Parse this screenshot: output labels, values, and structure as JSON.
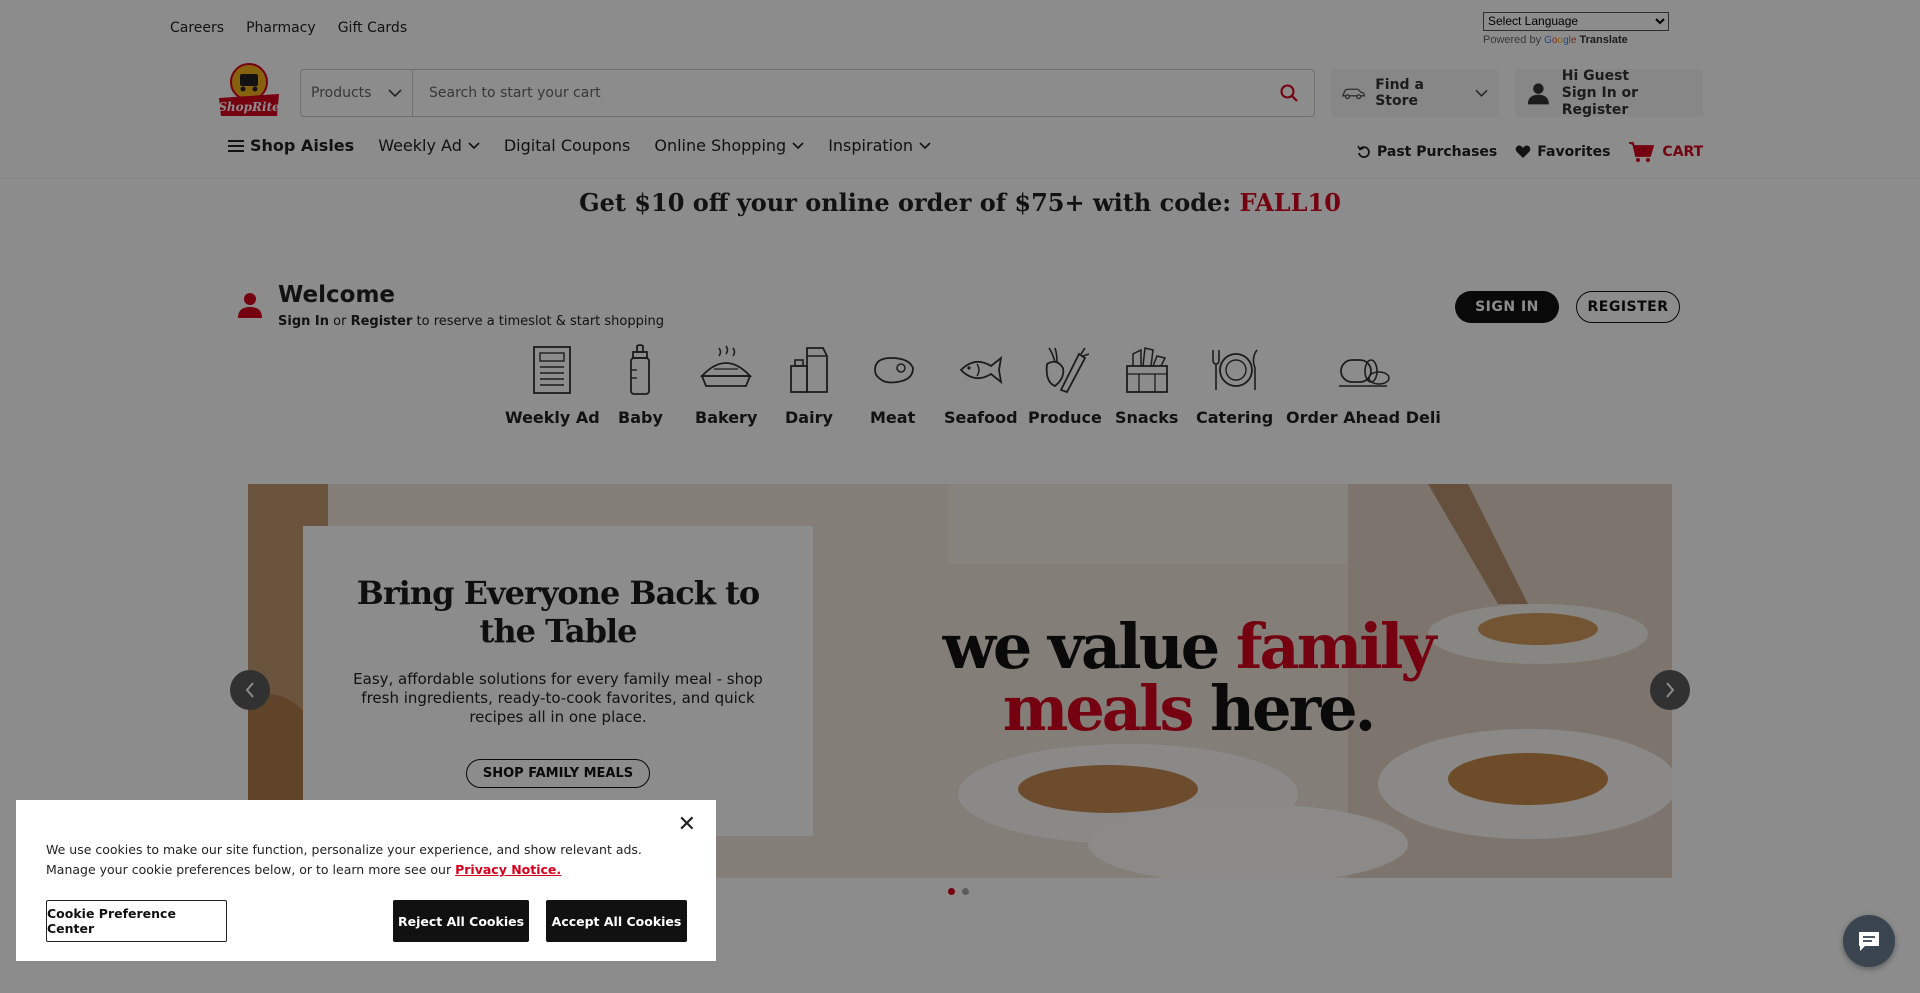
{
  "util_links": [
    "Careers",
    "Pharmacy",
    "Gift Cards"
  ],
  "language": {
    "selected": "Select Language",
    "powered_by": "Powered by",
    "google": "Google",
    "translate": "Translate"
  },
  "logo_text": "ShopRite",
  "search": {
    "category": "Products",
    "placeholder": "Search to start your cart"
  },
  "store": {
    "label": "Find a Store"
  },
  "account": {
    "greeting": "Hi Guest",
    "action": "Sign In or Register"
  },
  "nav": {
    "shop_aisles": "Shop Aisles",
    "weekly_ad": "Weekly Ad",
    "digital_coupons": "Digital Coupons",
    "online_shopping": "Online Shopping",
    "inspiration": "Inspiration",
    "past_purchases": "Past Purchases",
    "favorites": "Favorites",
    "cart": "CART"
  },
  "promo": {
    "text": "Get $10 off your online order of $75+ with code:",
    "code": "FALL10"
  },
  "welcome": {
    "title": "Welcome",
    "sign_in": "Sign In",
    "or": "or",
    "register": "Register",
    "rest": "to reserve a timeslot & start shopping"
  },
  "buttons": {
    "sign_in": "SIGN IN",
    "register": "REGISTER"
  },
  "categories": [
    {
      "label": "Weekly Ad",
      "icon": "newspaper-icon"
    },
    {
      "label": "Baby",
      "icon": "baby-bottle-icon"
    },
    {
      "label": "Bakery",
      "icon": "pie-icon"
    },
    {
      "label": "Dairy",
      "icon": "milk-carton-icon"
    },
    {
      "label": "Meat",
      "icon": "steak-icon"
    },
    {
      "label": "Seafood",
      "icon": "fish-icon"
    },
    {
      "label": "Produce",
      "icon": "vegetables-icon"
    },
    {
      "label": "Snacks",
      "icon": "snack-basket-icon"
    },
    {
      "label": "Catering",
      "icon": "plate-utensils-icon"
    },
    {
      "label": "Order Ahead Deli",
      "icon": "deli-meat-icon"
    }
  ],
  "hero": {
    "title": "Bring Everyone Back to the Table",
    "body": "Easy, affordable solutions for every family meal - shop fresh ingredients, ready-to-cook favorites, and quick recipes all in one place.",
    "cta": "SHOP FAMILY MEALS",
    "tag_1": "we value",
    "tag_2": "family",
    "tag_3": "meals",
    "tag_4": "here."
  },
  "cookie": {
    "text": "We use cookies to make our site function, personalize your experience, and show relevant ads. Manage your cookie preferences below, or to learn more see our",
    "link": "Privacy Notice.",
    "preference": "Cookie Preference Center",
    "reject": "Reject All Cookies",
    "accept": "Accept All Cookies"
  },
  "colors": {
    "brand_red": "#d6001c",
    "dark": "#111111"
  }
}
